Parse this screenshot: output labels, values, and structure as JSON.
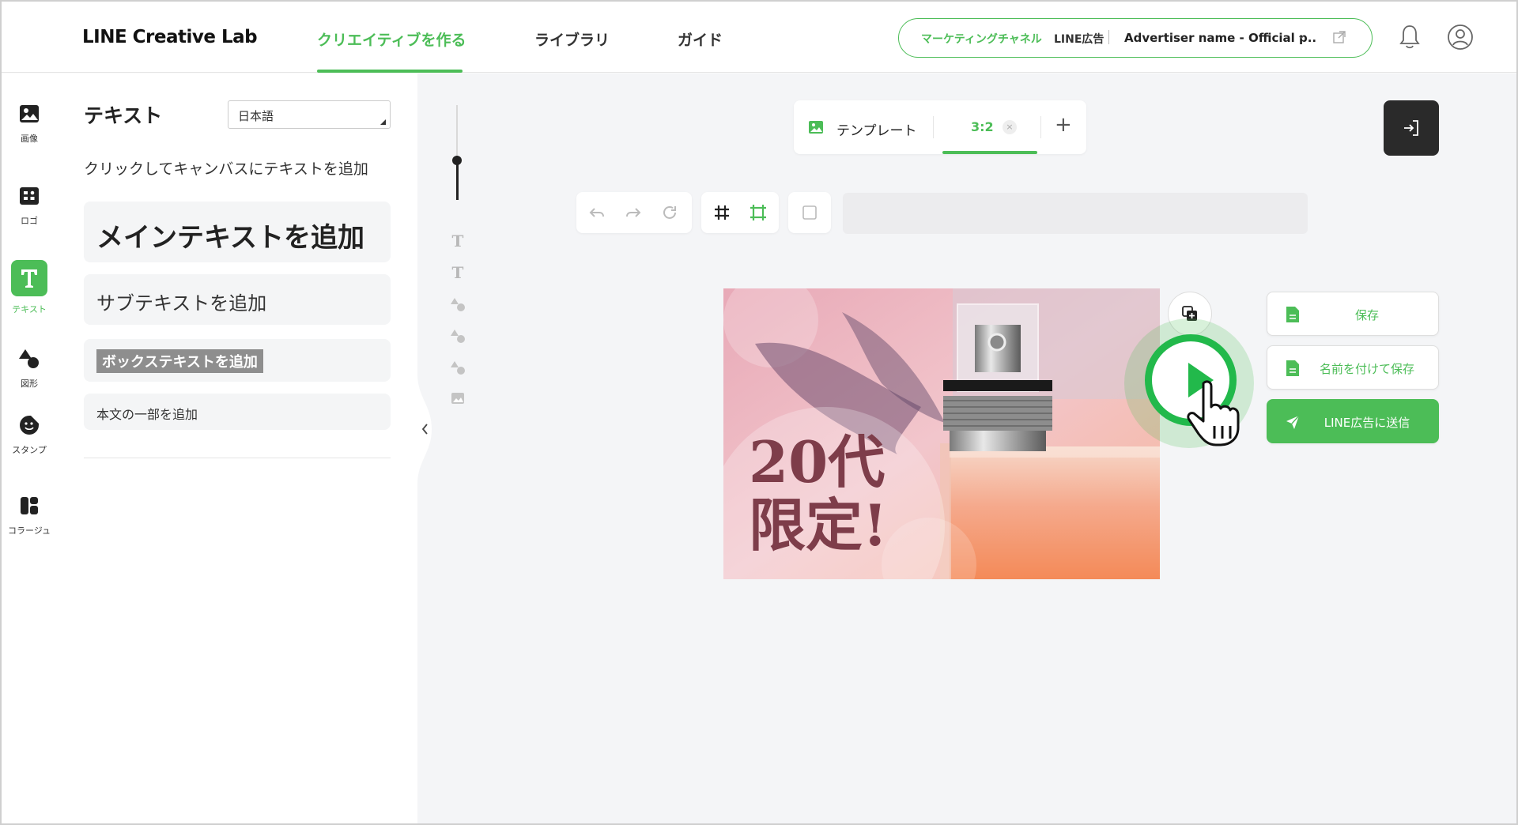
{
  "header": {
    "logo": "LINE Creative Lab",
    "nav": [
      {
        "label": "クリエイティブを作る",
        "active": true
      },
      {
        "label": "ライブラリ",
        "active": false
      },
      {
        "label": "ガイド",
        "active": false
      }
    ],
    "channel": {
      "label": "マーケティングチャネル",
      "type": "LINE広告",
      "account": "Advertiser name - Official p.."
    },
    "icons": [
      "chevron-down-icon",
      "external-link-icon",
      "bell-icon",
      "user-icon"
    ]
  },
  "rail": [
    {
      "label": "画像",
      "icon": "image-icon"
    },
    {
      "label": "ロゴ",
      "icon": "logo-icon"
    },
    {
      "label": "テキスト",
      "icon": "text-icon",
      "active": true
    },
    {
      "label": "図形",
      "icon": "shape-icon"
    },
    {
      "label": "スタンプ",
      "icon": "sticker-icon"
    },
    {
      "label": "コラージュ",
      "icon": "collage-icon"
    }
  ],
  "panel": {
    "title": "テキスト",
    "language": "日本語",
    "hint": "クリックしてキャンバスにテキストを追加",
    "options": {
      "main": "メインテキストを追加",
      "sub": "サブテキストを追加",
      "box": "ボックステキストを追加",
      "body": "本文の一部を追加"
    }
  },
  "canvas": {
    "template_label": "テンプレート",
    "ratio": "3:2",
    "close": "×",
    "add": "+",
    "artwork_text": "20代\n限定!",
    "actions": {
      "save": "保存",
      "save_as": "名前を付けて保存",
      "send": "LINE広告に送信"
    }
  },
  "colors": {
    "accent": "#4cbd57",
    "play": "#22b94b",
    "dark": "#2a2a2a",
    "art_text": "#7e3d4a"
  }
}
